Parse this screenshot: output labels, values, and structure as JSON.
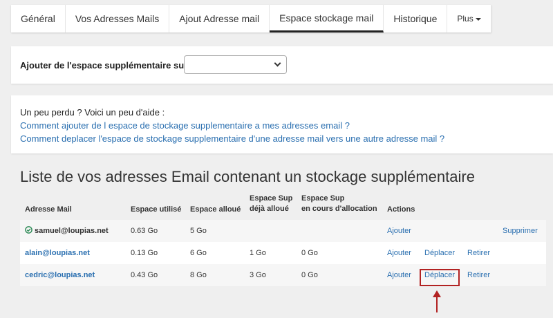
{
  "tabs": [
    {
      "label": "Général"
    },
    {
      "label": "Vos Adresses Mails"
    },
    {
      "label": "Ajout Adresse mail"
    },
    {
      "label": "Espace stockage mail"
    },
    {
      "label": "Historique"
    },
    {
      "label": "Plus"
    }
  ],
  "active_tab": "Espace stockage mail",
  "add_space": {
    "label": "Ajouter de l'espace supplémentaire sur :",
    "select_value": ""
  },
  "help": {
    "text": "Un peu perdu ? Voici un peu d'aide :",
    "link1": "Comment ajouter de l espace de stockage supplementaire a mes adresses email ?",
    "link2": "Comment deplacer l'espace de stockage supplementaire d'une adresse mail vers une autre adresse mail ?"
  },
  "list": {
    "title": "Liste de vos adresses Email contenant un stockage supplémentaire",
    "headers": {
      "email": "Adresse Mail",
      "used": "Espace utilisé",
      "allocated": "Espace alloué",
      "sup_allocated_1": "Espace Sup",
      "sup_allocated_2": "déjà alloué",
      "sup_pending_1": "Espace Sup",
      "sup_pending_2": "en cours d'allocation",
      "actions": "Actions"
    },
    "rows": [
      {
        "email": "samuel@loupias.net",
        "used": "0.63 Go",
        "allocated": "5 Go",
        "sup_allocated": "",
        "sup_pending": "",
        "add": "Ajouter",
        "move": "",
        "remove": "",
        "delete": "Supprimer"
      },
      {
        "email": "alain@loupias.net",
        "used": "0.13 Go",
        "allocated": "6 Go",
        "sup_allocated": "1 Go",
        "sup_pending": "0 Go",
        "add": "Ajouter",
        "move": "Déplacer",
        "remove": "Retirer",
        "delete": ""
      },
      {
        "email": "cedric@loupias.net",
        "used": "0.43 Go",
        "allocated": "8 Go",
        "sup_allocated": "3 Go",
        "sup_pending": "0 Go",
        "add": "Ajouter",
        "move": "Déplacer",
        "remove": "Retirer",
        "delete": ""
      }
    ]
  },
  "colors": {
    "link": "#2a6fb0",
    "highlight": "#b22222",
    "check": "#2e8b57"
  }
}
